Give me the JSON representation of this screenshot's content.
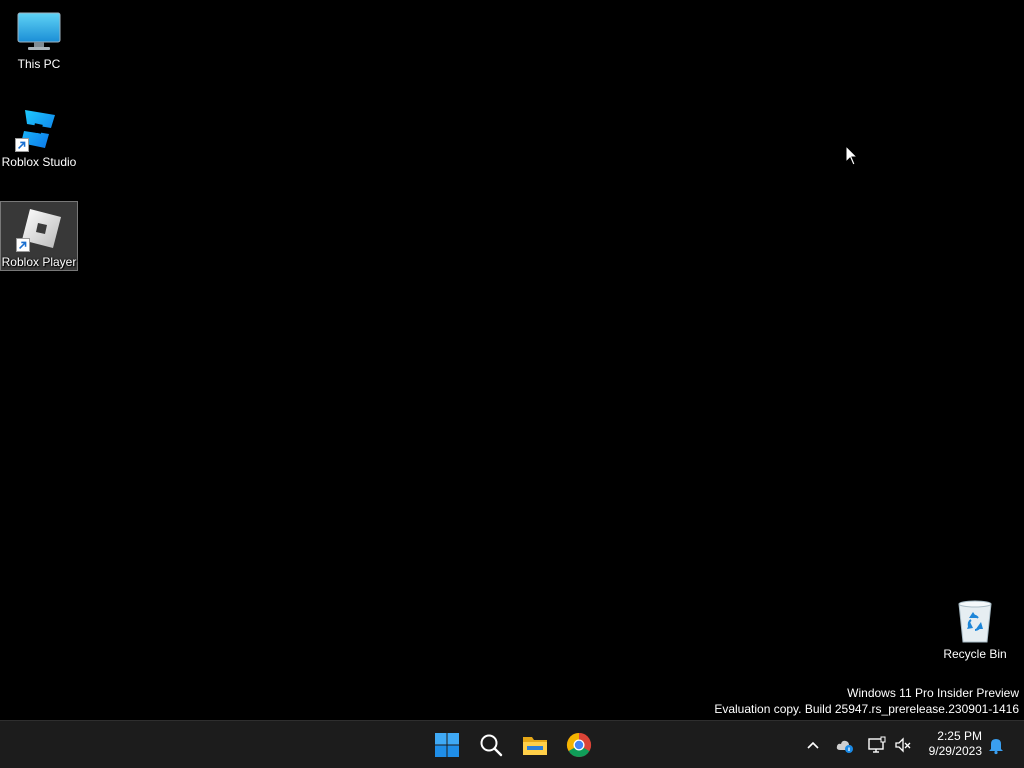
{
  "desktop": {
    "background_color": "#000000",
    "icons": [
      {
        "label": "This PC",
        "icon": "monitor-icon"
      },
      {
        "label": "Roblox Studio",
        "icon": "roblox-studio-icon"
      },
      {
        "label": "Roblox Player",
        "icon": "roblox-player-icon",
        "selected": true
      },
      {
        "label": "Recycle Bin",
        "icon": "recycle-bin-icon"
      }
    ]
  },
  "watermark": {
    "line1": "Windows 11 Pro Insider Preview",
    "line2": "Evaluation copy. Build 25947.rs_prerelease.230901-1416"
  },
  "taskbar": {
    "background_color": "#1c1c1c",
    "pinned": [
      {
        "name": "start",
        "icon": "windows-start-icon"
      },
      {
        "name": "search",
        "icon": "search-icon"
      },
      {
        "name": "file-explorer",
        "icon": "folder-icon"
      },
      {
        "name": "chrome",
        "icon": "chrome-icon"
      }
    ],
    "tray": [
      {
        "name": "show-hidden-icons",
        "icon": "chevron-up-icon"
      },
      {
        "name": "onedrive",
        "icon": "cloud-icon"
      },
      {
        "name": "network",
        "icon": "network-icon"
      },
      {
        "name": "volume",
        "icon": "volume-muted-icon"
      }
    ],
    "clock": {
      "time": "2:25 PM",
      "date": "9/29/2023"
    },
    "notifications_icon": "bell-icon"
  }
}
